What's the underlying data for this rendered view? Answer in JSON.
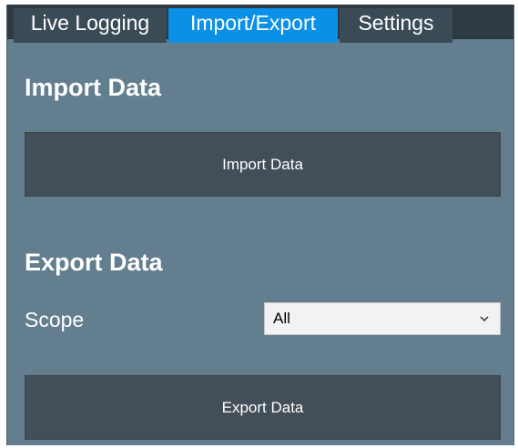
{
  "tabs": {
    "live_logging": "Live Logging",
    "import_export": "Import/Export",
    "settings": "Settings"
  },
  "import_section": {
    "heading": "Import Data",
    "button_label": "Import Data"
  },
  "export_section": {
    "heading": "Export Data",
    "scope_label": "Scope",
    "scope_value": "All",
    "button_label": "Export Data"
  },
  "colors": {
    "panel_background": "#627e8f",
    "active_tab": "#0a90e6",
    "inactive_tab": "#3b4b56",
    "button_background": "#434f58"
  },
  "icons": {
    "scope_dropdown": "chevron-down-icon"
  }
}
